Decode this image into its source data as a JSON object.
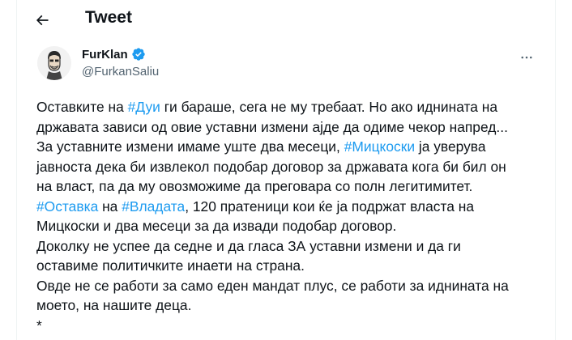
{
  "header": {
    "back_icon": "arrow-left-icon",
    "title": "Tweet"
  },
  "author": {
    "name": "FurKlan",
    "handle": "@FurkanSaliu",
    "verified_icon": "verified-badge-icon",
    "verified_color": "#1d9bf0",
    "more_icon": "more-horizontal-icon"
  },
  "colors": {
    "text": "#0f1419",
    "secondary": "#536471",
    "link": "#1d9bf0"
  },
  "tweet": {
    "l1": {
      "a": "Оставките на ",
      "tag": "#Дуи",
      "b": " ги бараше, сега не му требаат. Но ако иднината на"
    },
    "l2": "државата зависи од овие уставни измени ајде да одиме чекор напред...",
    "l3": {
      "a": "За уставните измени имаме уште два месеци, ",
      "tag": "#Мицкоски",
      "b": " ја уверува"
    },
    "l4": "јавноста дека би извлекол подобар договор за државата кога би бил он",
    "l5": "на власт, па да му овозможиме да преговара со полн легитимитет.",
    "l6": {
      "tag1": "#Оставка",
      "a": " на ",
      "tag2": "#Владата",
      "b": ", 120 пратеници кои ќе ја подржат власта на"
    },
    "l7": "Мицкоски и два месеци за да извади подобар договор.",
    "l8": "Доколку не успее да седне и да гласа ЗА уставни измени и да ги",
    "l9": "оставиме политичките инаети на страна.",
    "l10": "Овде не се работи за само еден мандат плус, се работи за иднината на",
    "l11": "моето, на нашите деца.",
    "l12": "*"
  }
}
